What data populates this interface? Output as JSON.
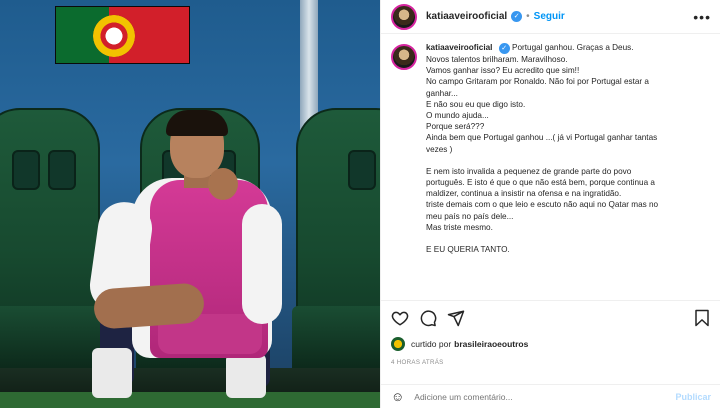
{
  "header": {
    "username": "katiaaveirooficial",
    "separator": "•",
    "follow_label": "Seguir",
    "more_label": "•••"
  },
  "caption": {
    "username": "katiaaveirooficial",
    "lines": [
      "Portugal ganhou. Graças a Deus.",
      "Novos talentos brilharam. Maravilhoso.",
      "Vamos ganhar isso? Eu acredito que sim!!",
      "No campo Gritaram por Ronaldo. Não foi por Portugal estar a",
      "ganhar...",
      "E não sou eu que digo isto.",
      "O mundo ajuda...",
      "Porque será???",
      "Ainda bem que Portugal ganhou ...( já vi Portugal ganhar tantas",
      "vezes )",
      "",
      "E nem isto invalida a pequenez de grande parte do povo",
      "português. E isto é que o que não está bem, porque continua a",
      "maldizer, continua a insistir na ofensa e na ingratidão.",
      "triste demais com o que leio e escuto não aqui no Qatar mas no",
      "meu país no país dele...",
      "Mas triste mesmo.",
      "",
      "E EU QUERIA TANTO."
    ]
  },
  "likes": {
    "prefix": "curtido por",
    "user": "brasileiraoeoutros"
  },
  "timestamp": "4 HORAS ATRÁS",
  "comment": {
    "placeholder": "Adicione um comentário...",
    "publish_label": "Publicar",
    "emoji_glyph": "☺"
  },
  "colors": {
    "accent": "#0095f6",
    "verified": "#3897f0",
    "publish_disabled": "#b3dbff"
  }
}
